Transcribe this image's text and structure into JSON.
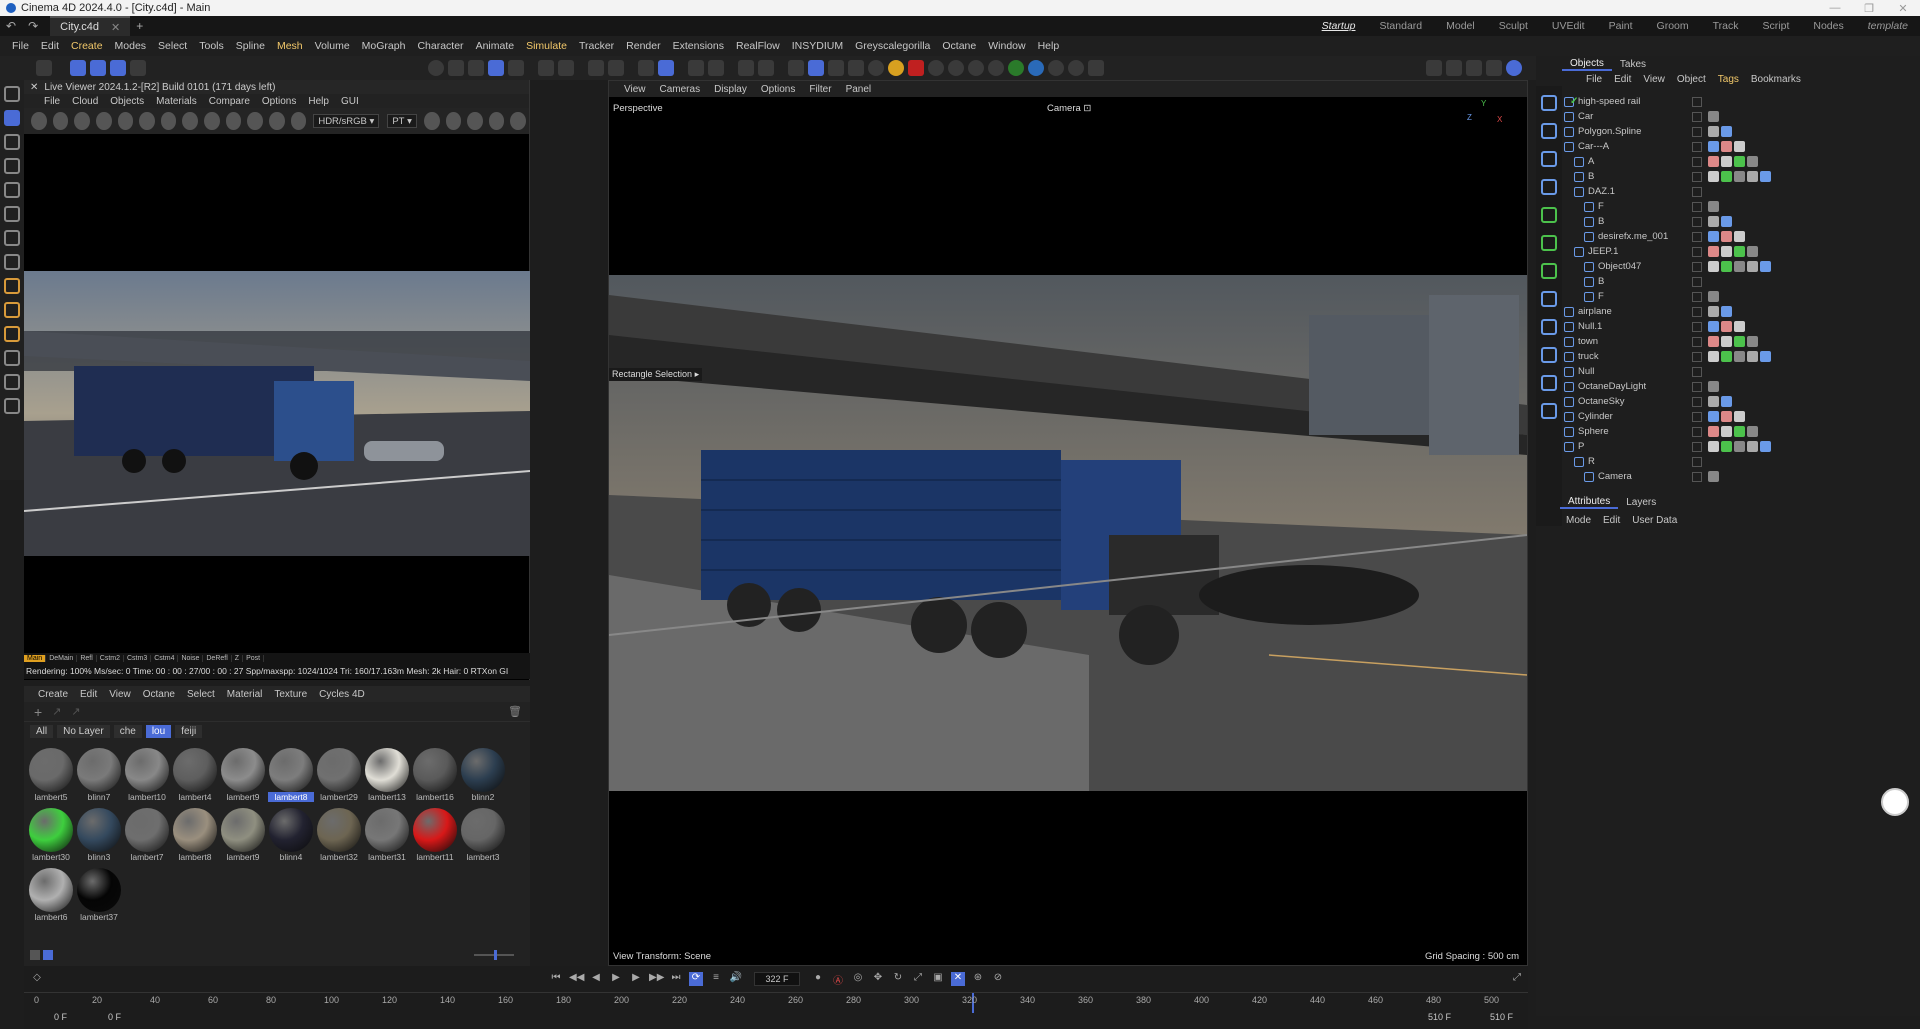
{
  "window": {
    "title": "Cinema 4D 2024.4.0 - [City.c4d] - Main"
  },
  "tabbar": {
    "doc_tab": "City.c4d",
    "add": "+",
    "layouts": [
      "Startup",
      "Standard",
      "Model",
      "Sculpt",
      "UVEdit",
      "Paint",
      "Groom",
      "Track",
      "Script",
      "Nodes",
      "template"
    ]
  },
  "menu": [
    "File",
    "Edit",
    "Create",
    "Modes",
    "Select",
    "Tools",
    "Spline",
    "Mesh",
    "Volume",
    "MoGraph",
    "Character",
    "Animate",
    "Simulate",
    "Tracker",
    "Render",
    "Extensions",
    "RealFlow",
    "INSYDIUM",
    "Greyscalegorilla",
    "Octane",
    "Window",
    "Help"
  ],
  "liveviewer": {
    "title": "Live Viewer 2024.1.2-[R2] Build 0101 (171 days left)",
    "menu": [
      "File",
      "Cloud",
      "Objects",
      "Materials",
      "Compare",
      "Options",
      "Help",
      "GUI"
    ],
    "colorspace": "HDR/sRGB",
    "kernel": "PT",
    "passes": [
      "Main",
      "DeMain",
      "Refl",
      "Cstm2",
      "Cstm3",
      "Cstm4",
      "Noise",
      "DeRefl",
      "Z",
      "Post"
    ],
    "status": "Rendering: 100%   Ms/sec: 0   Time: 00 : 00 : 27/00 : 00 : 27   Spp/maxspp: 1024/1024   Tri: 160/17.163m   Mesh: 2k   Hair: 0   RTXon   GI"
  },
  "materials": {
    "menu": [
      "Create",
      "Edit",
      "View",
      "Octane",
      "Select",
      "Material",
      "Texture",
      "Cycles 4D"
    ],
    "filters": [
      "All",
      "No Layer",
      "che",
      "lou",
      "feiji"
    ],
    "active_filter": "lou",
    "items": [
      {
        "name": "lambert5",
        "color": "#6a6a6a"
      },
      {
        "name": "blinn7",
        "color": "#7a7a7a"
      },
      {
        "name": "lambert10",
        "color": "#888888"
      },
      {
        "name": "lambert4",
        "color": "#5e5e5e"
      },
      {
        "name": "lambert9",
        "color": "#8c8c8c"
      },
      {
        "name": "lambert8",
        "color": "#7d7d7d"
      },
      {
        "name": "lambert29",
        "color": "#707070"
      },
      {
        "name": "lambert13",
        "color": "#e0ded6"
      },
      {
        "name": "lambert16",
        "color": "#5a5a5a"
      },
      {
        "name": "blinn2",
        "color": "#2c3e50"
      },
      {
        "name": "lambert30",
        "color": "#3ecf3e"
      },
      {
        "name": "blinn3",
        "color": "#34495e"
      },
      {
        "name": "lambert7",
        "color": "#6e6e6e"
      },
      {
        "name": "lambert8",
        "color": "#9a8f7e"
      },
      {
        "name": "lambert9",
        "color": "#8f8f80"
      },
      {
        "name": "blinn4",
        "color": "#222230"
      },
      {
        "name": "lambert32",
        "color": "#6d6552"
      },
      {
        "name": "lambert31",
        "color": "#777777"
      },
      {
        "name": "lambert11",
        "color": "#d81818"
      },
      {
        "name": "lambert3",
        "color": "#666666"
      },
      {
        "name": "lambert6",
        "color": "#b0b0b0"
      },
      {
        "name": "lambert37",
        "color": "#050505"
      }
    ],
    "selected_index": 5
  },
  "viewport": {
    "menu": [
      "View",
      "Cameras",
      "Display",
      "Options",
      "Filter",
      "Panel"
    ],
    "projection": "Perspective",
    "camera": "Camera",
    "selection_label": "Rectangle Selection",
    "view_transform": "View Transform: Scene",
    "grid_spacing": "Grid Spacing : 500 cm",
    "axis_labels": [
      "Y",
      "Z",
      "X"
    ]
  },
  "objects": {
    "tabs": [
      "Objects",
      "Takes"
    ],
    "menu": [
      "File",
      "Edit",
      "View",
      "Object",
      "Tags",
      "Bookmarks"
    ],
    "items": [
      {
        "name": "high-speed rail",
        "depth": 0
      },
      {
        "name": "Car",
        "depth": 0
      },
      {
        "name": "Polygon.Spline",
        "depth": 0
      },
      {
        "name": "Car---A",
        "depth": 0
      },
      {
        "name": "A",
        "depth": 1
      },
      {
        "name": "B",
        "depth": 1
      },
      {
        "name": "DAZ.1",
        "depth": 1
      },
      {
        "name": "F",
        "depth": 2
      },
      {
        "name": "B",
        "depth": 2
      },
      {
        "name": "desirefx.me_001",
        "depth": 2
      },
      {
        "name": "JEEP.1",
        "depth": 1
      },
      {
        "name": "Object047",
        "depth": 2
      },
      {
        "name": "B",
        "depth": 2
      },
      {
        "name": "F",
        "depth": 2
      },
      {
        "name": "airplane",
        "depth": 0
      },
      {
        "name": "Null.1",
        "depth": 0
      },
      {
        "name": "town",
        "depth": 0
      },
      {
        "name": "truck",
        "depth": 0
      },
      {
        "name": "Null",
        "depth": 0
      },
      {
        "name": "OctaneDayLight",
        "depth": 0
      },
      {
        "name": "OctaneSky",
        "depth": 0
      },
      {
        "name": "Cylinder",
        "depth": 0
      },
      {
        "name": "Sphere",
        "depth": 0
      },
      {
        "name": "P",
        "depth": 0
      },
      {
        "name": "R",
        "depth": 1
      },
      {
        "name": "Camera",
        "depth": 2
      }
    ]
  },
  "attributes": {
    "tabs": [
      "Attributes",
      "Layers"
    ],
    "menu": [
      "Mode",
      "Edit",
      "User Data"
    ]
  },
  "timeline": {
    "current_frame": "322 F",
    "ticks": [
      "0",
      "20",
      "40",
      "60",
      "80",
      "100",
      "120",
      "140",
      "160",
      "180",
      "200",
      "220",
      "240",
      "260",
      "280",
      "300",
      "320",
      "340",
      "360",
      "380",
      "400",
      "420",
      "440",
      "460",
      "480",
      "500"
    ],
    "start": "0 F",
    "start2": "0 F",
    "end": "510 F",
    "end2": "510 F"
  },
  "colors": {
    "accent": "#4a6bd6",
    "highlight": "#f2c86a",
    "check": "#4cc24c"
  }
}
